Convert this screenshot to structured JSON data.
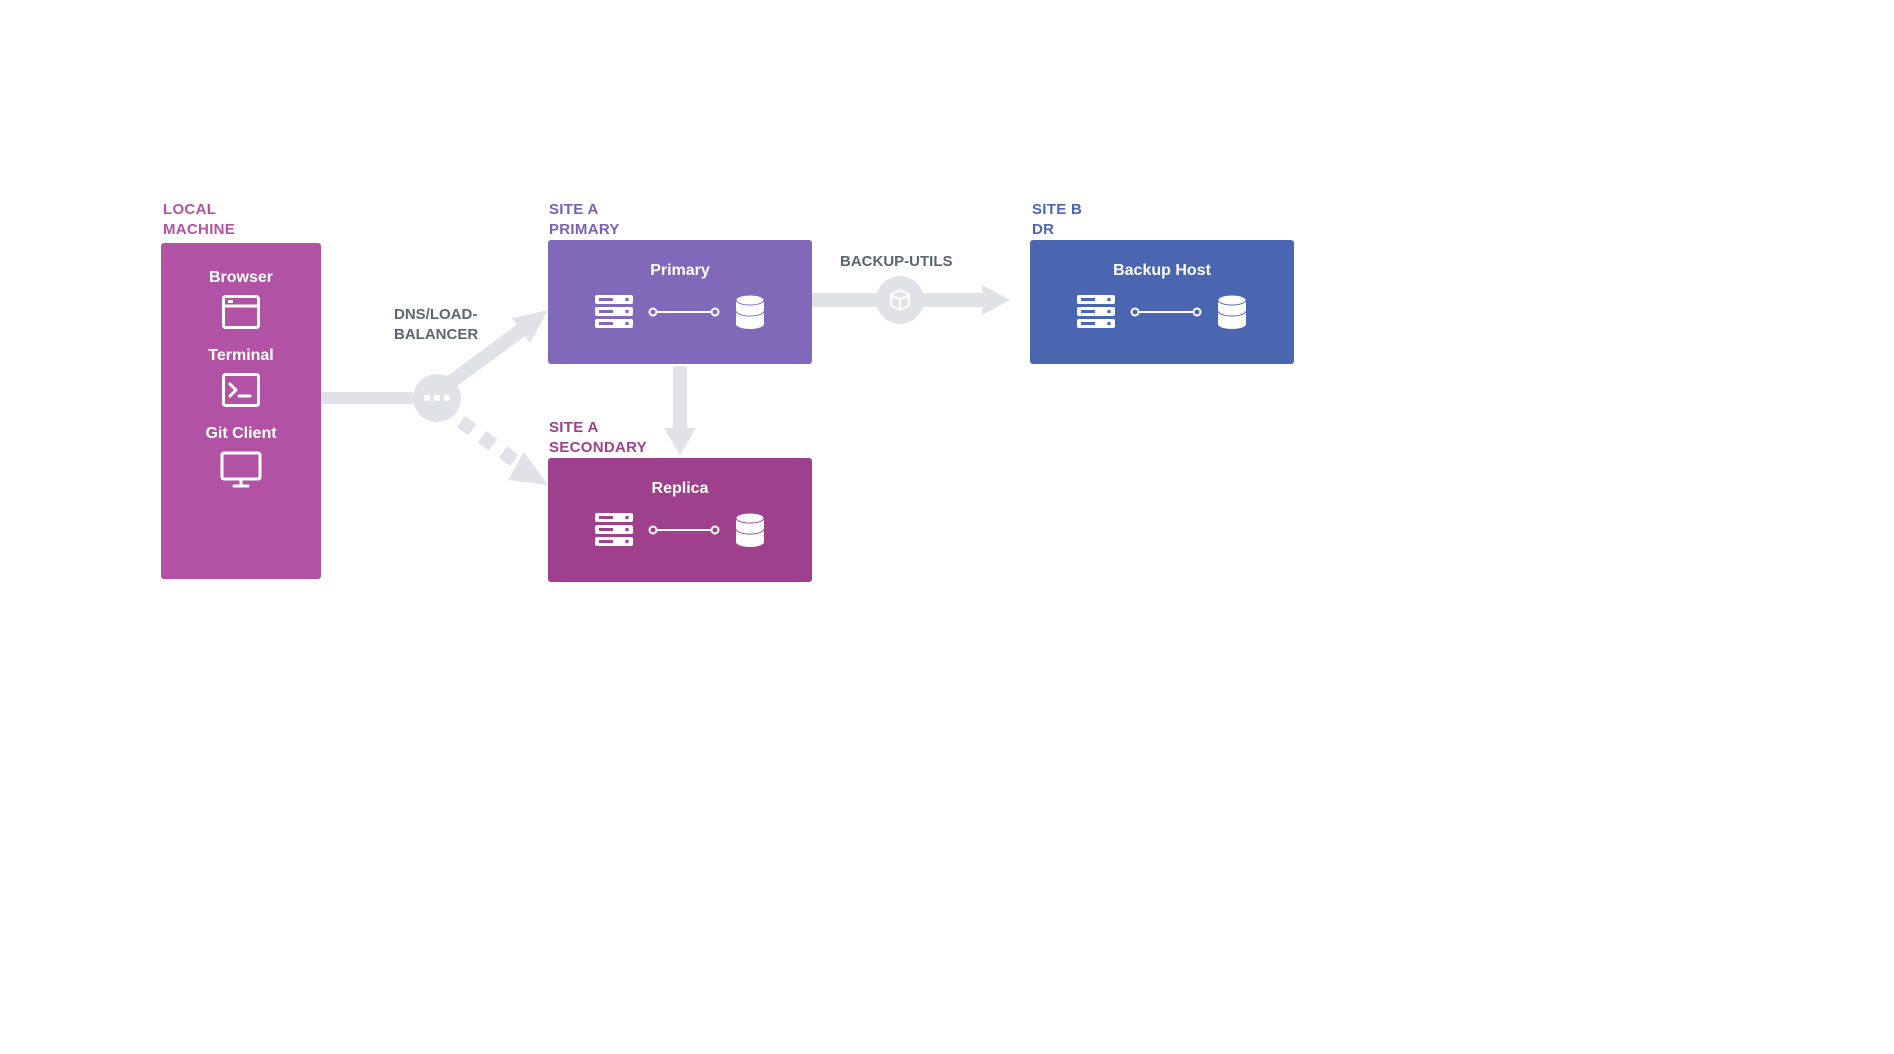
{
  "sections": {
    "local_machine": {
      "label": "LOCAL\nMACHINE"
    },
    "site_a_primary": {
      "label": "SITE A\nPRIMARY"
    },
    "site_a_secondary": {
      "label": "SITE A\nSECONDARY"
    },
    "site_b": {
      "label": "SITE B\nDR"
    }
  },
  "local_items": {
    "browser": {
      "label": "Browser"
    },
    "terminal": {
      "label": "Terminal"
    },
    "gitclient": {
      "label": "Git Client"
    }
  },
  "boxes": {
    "primary": {
      "title": "Primary"
    },
    "replica": {
      "title": "Replica"
    },
    "backup": {
      "title": "Backup Host"
    }
  },
  "connectors": {
    "dns_lb": {
      "label": "DNS/LOAD-\nBALANCER"
    },
    "backup_utils": {
      "label": "BACKUP-UTILS"
    }
  },
  "colors": {
    "magenta": "#b152a4",
    "purple": "#8169b9",
    "plum": "#9e408b",
    "blue": "#4a66b0",
    "grey": "#dfe3e7",
    "textgrey": "#5b6670"
  }
}
